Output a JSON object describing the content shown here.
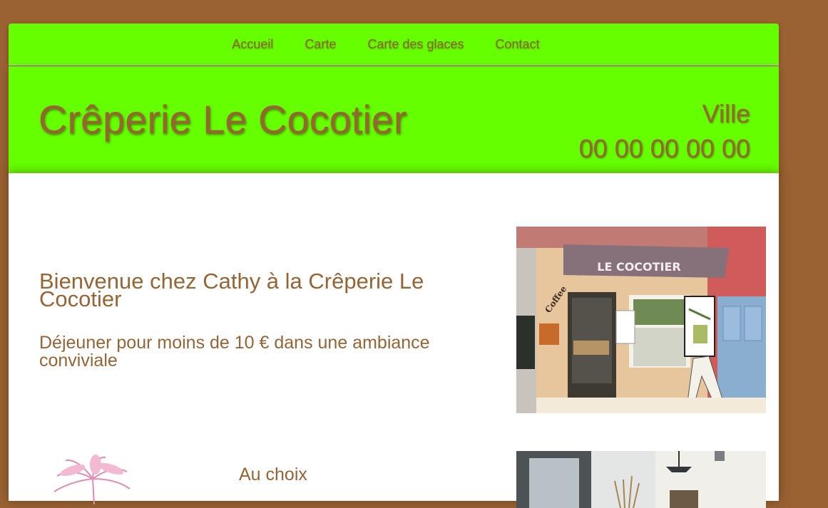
{
  "nav": {
    "items": [
      "Accueil",
      "Carte",
      "Carte des glaces",
      "Contact"
    ]
  },
  "header": {
    "title": "Crêperie Le Cocotier",
    "city": "Ville",
    "phone": "00 00 00 00 00"
  },
  "main": {
    "welcome_title": "Bienvenue chez Cathy à la Crêperie Le Cocotier",
    "welcome_subtitle": "Déjeuner pour moins de 10 € dans une ambiance conviviale",
    "feature_heading": "Au choix",
    "storefront_sign": "LE COCOTIER",
    "storefront_side_sign": "Coffee"
  },
  "colors": {
    "page_background": "#9a6233",
    "accent_green": "#66ff00",
    "text_brown": "#986434"
  }
}
